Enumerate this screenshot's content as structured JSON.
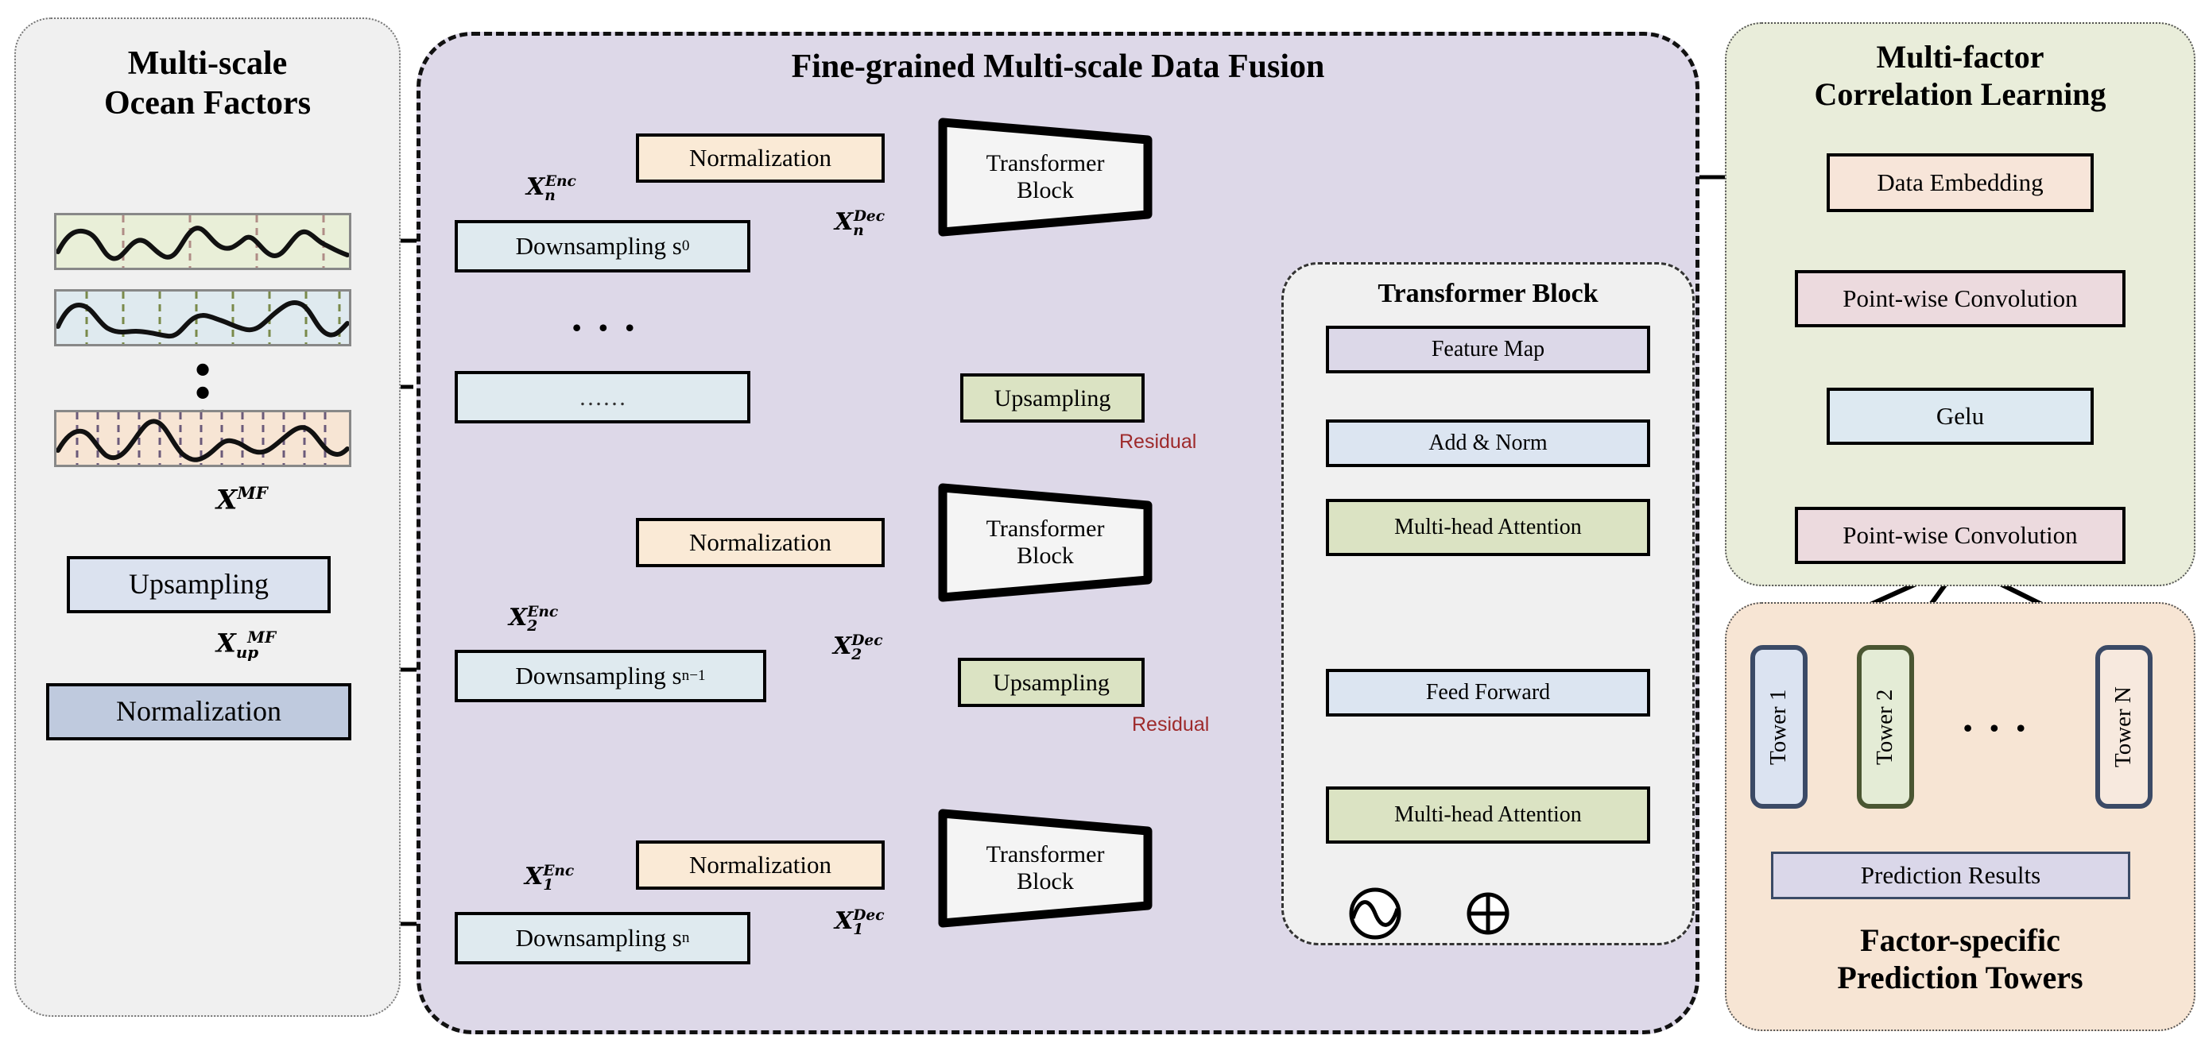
{
  "panels": {
    "left_title_line1": "Multi-scale",
    "left_title_line2": "Ocean Factors",
    "center_title": "Fine-grained Multi-scale Data Fusion",
    "transformer_detail_title": "Transformer Block",
    "corr_title_line1": "Multi-factor",
    "corr_title_line2": "Correlation Learning",
    "tower_title_line1": "Factor-specific",
    "tower_title_line2": "Prediction Towers"
  },
  "left": {
    "upsampling": "Upsampling",
    "normalization": "Normalization",
    "label_xmf": "X",
    "label_xmf_sup": "MF",
    "label_xup": "X",
    "label_xup_sub": "up",
    "label_xup_sup": "MF",
    "vertical_dots": "⋮"
  },
  "center": {
    "rows": [
      {
        "downsampling": "Downsampling s",
        "downsampling_sup": "0",
        "normalization": "Normalization",
        "transformer_line1": "Transformer",
        "transformer_line2": "Block",
        "enc_label": "X",
        "enc_sub": "n",
        "enc_sup": "Enc",
        "dec_label": "X",
        "dec_sub": "n",
        "dec_sup": "Dec"
      },
      {
        "downsampling": "……",
        "upsampling": "Upsampling"
      },
      {
        "downsampling": "Downsampling s",
        "downsampling_sup": "n−1",
        "normalization": "Normalization",
        "transformer_line1": "Transformer",
        "transformer_line2": "Block",
        "upsampling": "Upsampling",
        "residual": "Residual",
        "enc_label": "X",
        "enc_sub": "2",
        "enc_sup": "Enc",
        "dec_label": "X",
        "dec_sub": "2",
        "dec_sup": "Dec"
      },
      {
        "downsampling": "Downsampling s",
        "downsampling_sup": "n",
        "normalization": "Normalization",
        "transformer_line1": "Transformer",
        "transformer_line2": "Block",
        "residual": "Residual",
        "enc_label": "X",
        "enc_sub": "1",
        "enc_sup": "Enc",
        "dec_label": "X",
        "dec_sub": "1",
        "dec_sup": "Dec"
      }
    ],
    "ellipsis": "• • •"
  },
  "transformer_detail": {
    "feature_map": "Feature Map",
    "add_norm": "Add & Norm",
    "multi_head_attention_top": "Multi-head Attention",
    "feed_forward": "Feed Forward",
    "multi_head_attention_bottom": "Multi-head Attention",
    "positional_icon": "sine-wave-icon",
    "add_icon": "circled-plus-icon"
  },
  "correlation": {
    "data_embedding": "Data Embedding",
    "point_wise_conv_1": "Point-wise Convolution",
    "gelu": "Gelu",
    "point_wise_conv_2": "Point-wise Convolution"
  },
  "towers": {
    "tower1": "Tower 1",
    "tower2": "Tower 2",
    "towerN": "Tower N",
    "ellipsis": "• • •",
    "prediction_results": "Prediction Results"
  },
  "colors": {
    "center_panel": "#ddd8e8",
    "left_panel": "#f0f0f0",
    "corr_panel": "#e9edda",
    "tower_panel": "#f7e5d4",
    "normalization": "#faead6",
    "downsampling": "#dfeaef",
    "upsampling": "#dbe3c3",
    "residual_red": "#9e2a2b",
    "wave_green": "#e9efd8",
    "wave_blue": "#dfeaef",
    "wave_peach": "#f7e5d4"
  }
}
